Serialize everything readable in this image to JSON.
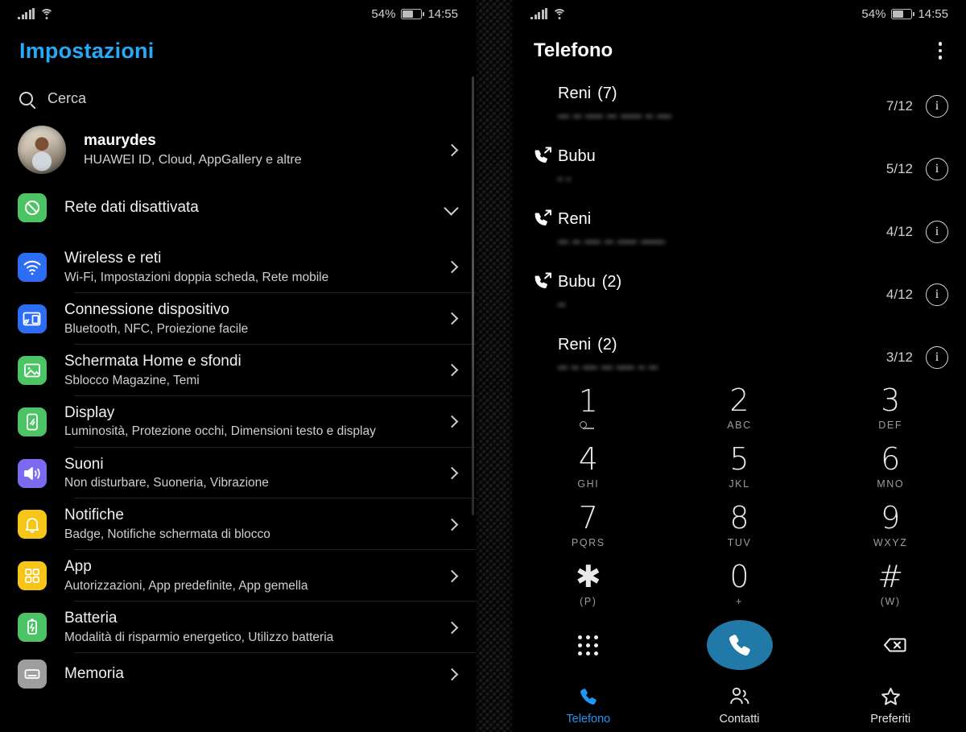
{
  "status_bar": {
    "battery_percent": "54%",
    "battery_level": 54,
    "time": "14:55",
    "signal_icon": "signal-bars-icon",
    "wifi_icon": "wifi-icon",
    "battery_icon": "battery-icon"
  },
  "settings": {
    "title": "Impostazioni",
    "search": {
      "placeholder": "Cerca",
      "icon": "search-icon"
    },
    "account": {
      "name": "maurydes",
      "subtitle": "HUAWEI ID, Cloud, AppGallery e altre",
      "avatar": "user-avatar",
      "chevron": "chevron-right-icon"
    },
    "items": [
      {
        "name": "Rete dati disattivata",
        "sub": "",
        "icon": "data-network-off-icon",
        "color": "#4cc364",
        "accessory": "chevron-down-icon"
      },
      {
        "name": "Wireless e reti",
        "sub": "Wi-Fi, Impostazioni doppia scheda, Rete mobile",
        "icon": "wifi-icon",
        "color": "#2d6df6",
        "accessory": "chevron-right-icon"
      },
      {
        "name": "Connessione dispositivo",
        "sub": "Bluetooth, NFC, Proiezione facile",
        "icon": "device-connection-icon",
        "color": "#2d6df6",
        "accessory": "chevron-right-icon"
      },
      {
        "name": "Schermata Home e sfondi",
        "sub": "Sblocco Magazine, Temi",
        "icon": "wallpaper-icon",
        "color": "#4cc364",
        "accessory": "chevron-right-icon"
      },
      {
        "name": "Display",
        "sub": "Luminosità, Protezione occhi, Dimensioni testo e display",
        "icon": "display-icon",
        "color": "#4cc364",
        "accessory": "chevron-right-icon"
      },
      {
        "name": "Suoni",
        "sub": "Non disturbare, Suoneria, Vibrazione",
        "icon": "speaker-icon",
        "color": "#7c6bf0",
        "accessory": "chevron-right-icon"
      },
      {
        "name": "Notifiche",
        "sub": "Badge, Notifiche schermata di blocco",
        "icon": "bell-icon",
        "color": "#f5c518",
        "accessory": "chevron-right-icon"
      },
      {
        "name": "App",
        "sub": "Autorizzazioni, App predefinite, App gemella",
        "icon": "apps-grid-icon",
        "color": "#f5c518",
        "accessory": "chevron-right-icon"
      },
      {
        "name": "Batteria",
        "sub": "Modalità di risparmio energetico, Utilizzo batteria",
        "icon": "battery-charging-icon",
        "color": "#4cc364",
        "accessory": "chevron-right-icon"
      },
      {
        "name": "Memoria",
        "sub": "",
        "icon": "storage-icon",
        "color": "#9e9e9e",
        "accessory": "chevron-right-icon"
      }
    ]
  },
  "phone": {
    "title": "Telefono",
    "overflow_icon": "overflow-menu-icon",
    "calls": [
      {
        "name": "Reni",
        "count": "(7)",
        "date": "7/12",
        "type_icon": "",
        "info_icon": "info-icon",
        "number_redacted": true
      },
      {
        "name": "Bubu",
        "count": "",
        "date": "5/12",
        "type_icon": "outgoing-call-icon",
        "info_icon": "info-icon",
        "number_redacted": true
      },
      {
        "name": "Reni",
        "count": "",
        "date": "4/12",
        "type_icon": "outgoing-call-icon",
        "info_icon": "info-icon",
        "number_redacted": true
      },
      {
        "name": "Bubu",
        "count": "(2)",
        "date": "4/12",
        "type_icon": "outgoing-call-icon",
        "info_icon": "info-icon",
        "number_redacted": true
      },
      {
        "name": "Reni",
        "count": "(2)",
        "date": "3/12",
        "type_icon": "",
        "info_icon": "info-icon",
        "number_redacted": true
      }
    ],
    "dialpad": [
      {
        "digit": "1",
        "letters": "",
        "sub_icon": "voicemail-icon"
      },
      {
        "digit": "2",
        "letters": "ABC",
        "sub_icon": ""
      },
      {
        "digit": "3",
        "letters": "DEF",
        "sub_icon": ""
      },
      {
        "digit": "4",
        "letters": "GHI",
        "sub_icon": ""
      },
      {
        "digit": "5",
        "letters": "JKL",
        "sub_icon": ""
      },
      {
        "digit": "6",
        "letters": "MNO",
        "sub_icon": ""
      },
      {
        "digit": "7",
        "letters": "PQRS",
        "sub_icon": ""
      },
      {
        "digit": "8",
        "letters": "TUV",
        "sub_icon": ""
      },
      {
        "digit": "9",
        "letters": "WXYZ",
        "sub_icon": ""
      },
      {
        "digit": "✱",
        "letters": "(P)",
        "sub_icon": ""
      },
      {
        "digit": "0",
        "letters": "+",
        "sub_icon": ""
      },
      {
        "digit": "#",
        "letters": "(W)",
        "sub_icon": ""
      }
    ],
    "actions": {
      "keypad_icon": "keypad-icon",
      "call_icon": "call-handset-icon",
      "call_button_color": "#2079a6",
      "delete_icon": "backspace-icon"
    },
    "tabs": [
      {
        "label": "Telefono",
        "icon": "phone-icon",
        "active": true
      },
      {
        "label": "Contatti",
        "icon": "contacts-icon",
        "active": false
      },
      {
        "label": "Preferiti",
        "icon": "star-icon",
        "active": false
      }
    ],
    "accent_color": "#2196f3"
  }
}
